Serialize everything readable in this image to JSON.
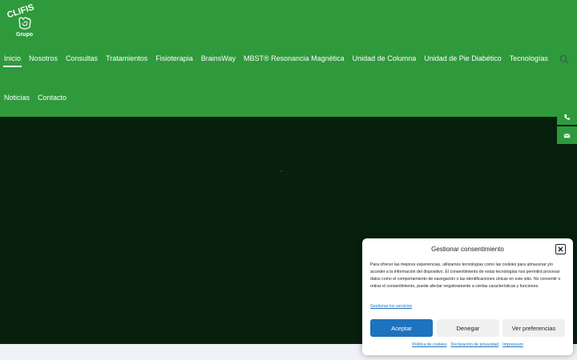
{
  "logo": {
    "text": "CLIFIS Grupo",
    "icon": "hand-spiral-logo"
  },
  "nav": {
    "row1": [
      {
        "label": "Inicio",
        "active": true
      },
      {
        "label": "Nosotros"
      },
      {
        "label": "Consultas"
      },
      {
        "label": "Tratamientos"
      },
      {
        "label": "Fisioterapia"
      },
      {
        "label": "BrainsWay"
      },
      {
        "label": "MBST® Resonancia Magnética"
      },
      {
        "label": "Unidad de Columna"
      },
      {
        "label": "Unidad de Pie Diabético"
      },
      {
        "label": "Tecnologías"
      }
    ],
    "row2": [
      {
        "label": "Noticias"
      },
      {
        "label": "Contacto"
      }
    ],
    "search_icon": "search-icon"
  },
  "side_tabs": [
    "phone-icon",
    "envelope-icon"
  ],
  "consent": {
    "title": "Gestionar consentimiento",
    "body": "Para ofrecer las mejores experiencias, utilizamos tecnologías como las cookies para almacenar y/o acceder a la información del dispositivo. El consentimiento de estas tecnologías nos permitirá procesar datos como el comportamiento de navegación o las identificaciones únicas en este sitio. No consentir o retirar el consentimiento, puede afectar negativamente a ciertas características y funciones.",
    "manage_link": "Gestionar los servicios",
    "accept": "Aceptar",
    "deny": "Denegar",
    "preferences": "Ver preferencias",
    "links": [
      "Política de cookies",
      "Declaración de privacidad",
      "Impressum"
    ]
  },
  "colors": {
    "brand_green": "#2e9a3c",
    "hero_dark": "#06200d",
    "button_blue": "#1e73be"
  }
}
